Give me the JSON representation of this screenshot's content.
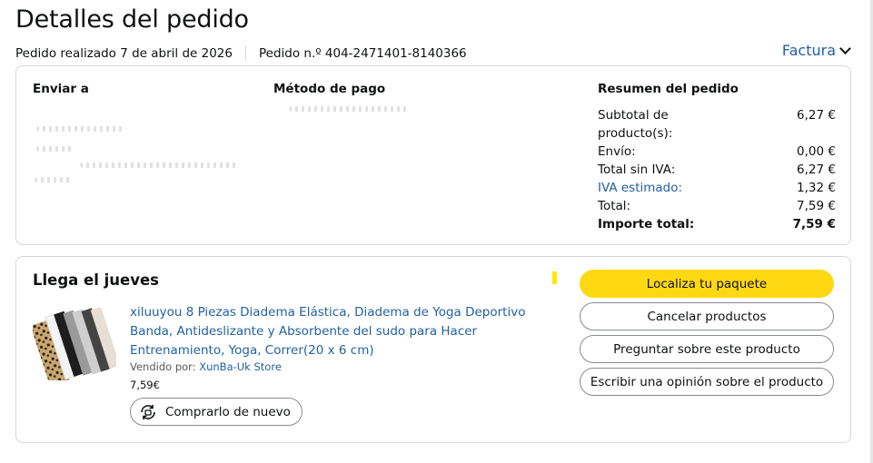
{
  "header": {
    "title": "Detalles del pedido",
    "order_date": "Pedido realizado 7 de abril de 2026",
    "order_number": "Pedido n.º 404-2471401-8140366",
    "invoice_label": "Factura"
  },
  "details": {
    "ship_to_label": "Enviar a",
    "payment_label": "Método de pago",
    "summary_label": "Resumen del pedido",
    "summary": {
      "subtotal_label": "Subtotal de producto(s):",
      "subtotal_value": "6,27 €",
      "shipping_label": "Envío:",
      "shipping_value": "0,00 €",
      "pre_tax_label": "Total sin IVA:",
      "pre_tax_value": "6,27 €",
      "tax_label": "IVA estimado:",
      "tax_value": "1,32 €",
      "total_label": "Total:",
      "total_value": "7,59 €",
      "grand_total_label": "Importe total:",
      "grand_total_value": "7,59 €"
    }
  },
  "shipment": {
    "arrival": "Llega el jueves",
    "product_title": "xiluuyou 8 Piezas Diadema Elástica, Diadema de Yoga Deportivo Banda, Antideslizante y Absorbente del sudo para Hacer Entrenamiento, Yoga, Correr(20 x 6 cm)",
    "sold_by_label": "Vendido por:",
    "seller": "XunBa-Uk Store",
    "price": "7,59€",
    "rebuy_label": "Comprarlo de nuevo",
    "actions": {
      "track": "Localiza tu paquete",
      "cancel": "Cancelar productos",
      "ask": "Preguntar sobre este producto",
      "review": "Escribir una opinión sobre el producto"
    }
  },
  "colors": {
    "link": "#2162a1",
    "primary_button": "#ffd814",
    "border": "#d5d9d9"
  },
  "icons": [
    "chevron-down-icon",
    "rebuy-icon"
  ]
}
